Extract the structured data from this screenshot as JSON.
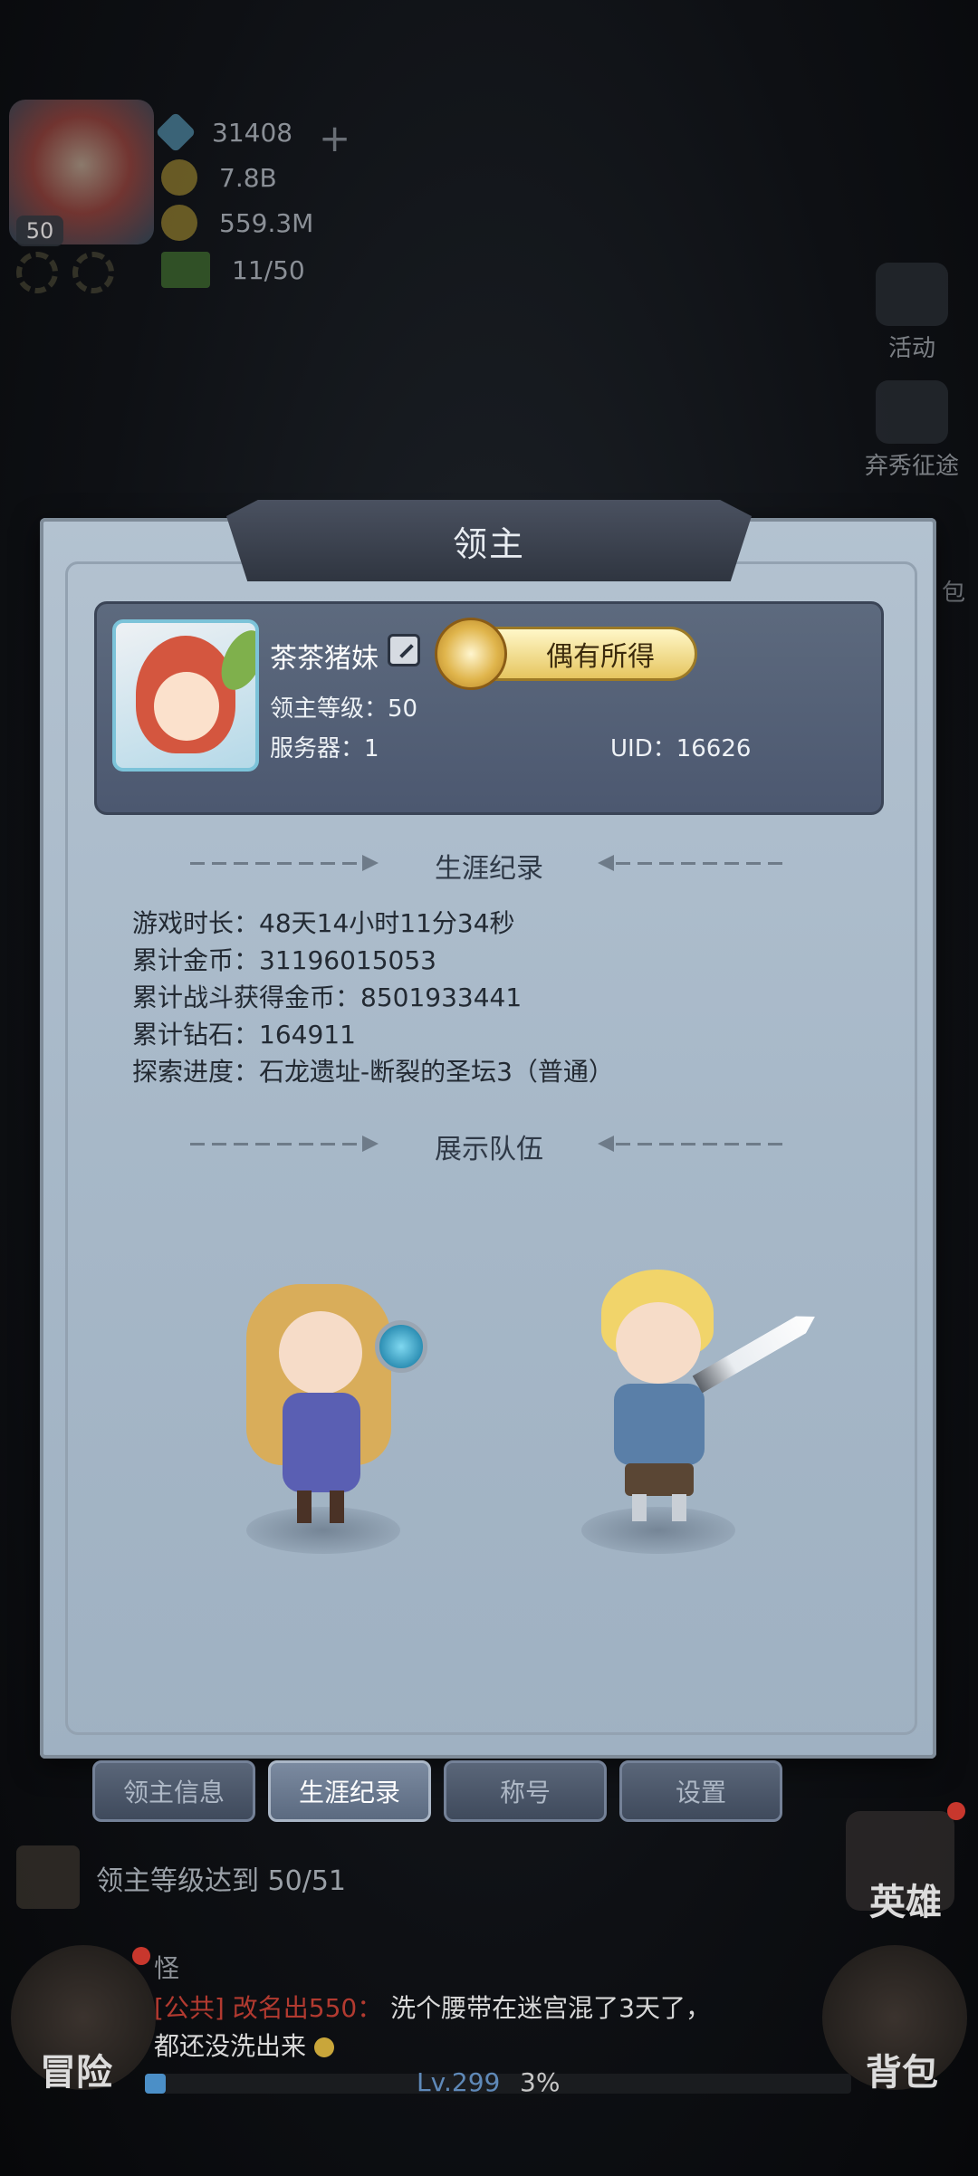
{
  "hud": {
    "level": "50",
    "diamonds": "31408",
    "gold": "7.8B",
    "coins": "559.3M",
    "stamina": "11/50",
    "icons": [
      "diamond-icon",
      "gold-coin-icon",
      "coin-icon",
      "stamina-arrow-icon"
    ]
  },
  "side_menu": {
    "activity": "活动",
    "expedition": "弃秀征途",
    "bag_partial": "包"
  },
  "dialog": {
    "title": "领主",
    "profile": {
      "name": "茶茶猪妹",
      "title_badge": "偶有所得",
      "level_line": "领主等级：50",
      "server_line": "服务器：1",
      "uid_line": "UID：16626"
    },
    "career_header": "生涯纪录",
    "stats": [
      "游戏时长：48天14小时11分34秒",
      "累计金币：31196015053",
      "累计战斗获得金币：8501933441",
      "累计钻石：164911",
      "探索进度：石龙遗址-断裂的圣坛3（普通）"
    ],
    "team_header": "展示队伍",
    "tabs": [
      "领主信息",
      "生涯纪录",
      "称号",
      "设置"
    ],
    "active_tab": "生涯纪录"
  },
  "bottom": {
    "quest": "领主等级达到 50/51",
    "hero_label": "英雄",
    "adventure_label": "冒险",
    "bag_label": "背包",
    "chat": {
      "sender_prefix": "怪",
      "channel": "[公共]",
      "user": "改名出550：",
      "message": "洗个腰带在迷宫混了3天了，",
      "message2": "都还没洗出来"
    },
    "xp_level": "Lv.299",
    "xp_percent": "3%"
  },
  "colors": {
    "paper": "#a7b8c8",
    "card": "#54607a",
    "channel_red": "#b23a30",
    "gold_text": "#e6c660"
  }
}
